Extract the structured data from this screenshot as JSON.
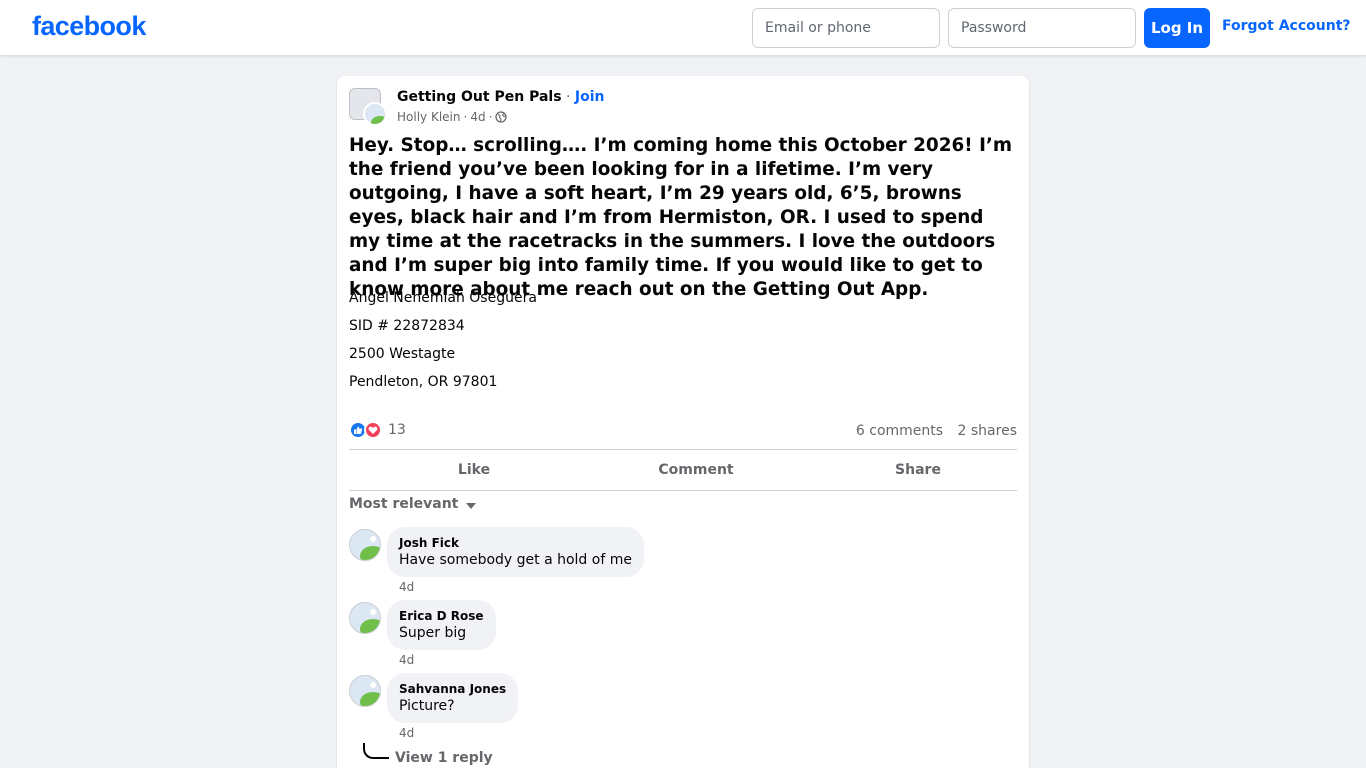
{
  "header": {
    "logo": "facebook",
    "email_placeholder": "Email or phone",
    "password_placeholder": "Password",
    "login_label": "Log In",
    "forgot_label": "Forgot Account?"
  },
  "post": {
    "group_name": "Getting Out Pen Pals",
    "separator": "·",
    "join_label": "Join",
    "author": "Holly Klein",
    "time": "4d",
    "meta_sep": "·",
    "text": "Hey. Stop… scrolling…. I’m coming home this October 2026! I’m the friend you’ve been looking for in a lifetime. I’m very outgoing, I have a soft heart, I’m 29 years old, 6’5, browns eyes, black hair and I’m from Hermiston, OR. I used to spend my time at the racetracks in the summers. I love the outdoors and I’m super big into family time. If you would like to get to know more about me reach out on the Getting Out App.",
    "info_lines": [
      "Angel Nehemiah Oseguera",
      "SID # 22872834",
      "2500 Westagte",
      "Pendleton, OR 97801"
    ],
    "reaction_count": "13",
    "comments_count": "6 comments",
    "shares_count": "2 shares"
  },
  "actions": {
    "like": "Like",
    "comment": "Comment",
    "share": "Share"
  },
  "comments_section": {
    "sort_label": "Most relevant",
    "comments": [
      {
        "author": "Josh Fick",
        "text": "Have somebody get a hold of me",
        "time": "4d"
      },
      {
        "author": "Erica D Rose",
        "text": "Super big",
        "time": "4d"
      },
      {
        "author": "Sahvanna Jones",
        "text": "Picture?",
        "time": "4d"
      }
    ],
    "view_reply_label": "View 1 reply"
  },
  "colors": {
    "brand_blue": "#0866ff",
    "page_bg": "#f0f2f5",
    "like_blue": "#1877f2",
    "love_red": "#f33e58"
  }
}
